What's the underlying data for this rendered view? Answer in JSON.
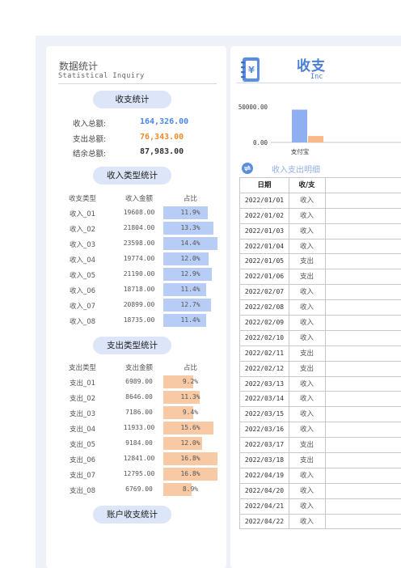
{
  "left": {
    "title": "数据统计",
    "subtitle": "Statistical Inquiry",
    "summary_pill": "收支统计",
    "summary": [
      {
        "label": "收入总额:",
        "value": "164,326.00",
        "color": "#4a86e8"
      },
      {
        "label": "支出总额:",
        "value": "76,343.00",
        "color": "#f08a2c"
      },
      {
        "label": "结余总额:",
        "value": "87,983.00",
        "color": "#333333"
      }
    ],
    "income_pill": "收入类型统计",
    "income_headers": {
      "type": "收支类型",
      "amount": "收入金额",
      "pct": "占比"
    },
    "income_rows": [
      {
        "type": "收入_01",
        "amount": "19608.00",
        "pct": "11.9%",
        "share": 0.119
      },
      {
        "type": "收入_02",
        "amount": "21804.00",
        "pct": "13.3%",
        "share": 0.133
      },
      {
        "type": "收入_03",
        "amount": "23598.00",
        "pct": "14.4%",
        "share": 0.144
      },
      {
        "type": "收入_04",
        "amount": "19774.00",
        "pct": "12.0%",
        "share": 0.12
      },
      {
        "type": "收入_05",
        "amount": "21190.00",
        "pct": "12.9%",
        "share": 0.129
      },
      {
        "type": "收入_06",
        "amount": "18718.00",
        "pct": "11.4%",
        "share": 0.114
      },
      {
        "type": "收入_07",
        "amount": "20899.00",
        "pct": "12.7%",
        "share": 0.127
      },
      {
        "type": "收入_08",
        "amount": "18735.00",
        "pct": "11.4%",
        "share": 0.114
      }
    ],
    "expense_pill": "支出类型统计",
    "expense_headers": {
      "type": "支出类型",
      "amount": "支出金额",
      "pct": "占比"
    },
    "expense_rows": [
      {
        "type": "支出_01",
        "amount": "6989.00",
        "pct": "9.2%",
        "share": 0.092
      },
      {
        "type": "支出_02",
        "amount": "8646.00",
        "pct": "11.3%",
        "share": 0.113
      },
      {
        "type": "支出_03",
        "amount": "7186.00",
        "pct": "9.4%",
        "share": 0.094
      },
      {
        "type": "支出_04",
        "amount": "11933.00",
        "pct": "15.6%",
        "share": 0.156
      },
      {
        "type": "支出_05",
        "amount": "9184.00",
        "pct": "12.0%",
        "share": 0.12
      },
      {
        "type": "支出_06",
        "amount": "12841.00",
        "pct": "16.8%",
        "share": 0.168
      },
      {
        "type": "支出_07",
        "amount": "12795.00",
        "pct": "16.8%",
        "share": 0.168
      },
      {
        "type": "支出_08",
        "amount": "6769.00",
        "pct": "8.9%",
        "share": 0.089
      }
    ],
    "account_pill": "账户收支统计",
    "colors": {
      "income_bar": "#b7cdf6",
      "expense_bar": "#f7c9a4"
    }
  },
  "right": {
    "title": "收支",
    "subtitle": "Inc",
    "icon": "ledger-book-icon",
    "detail_title": "收入支出明细",
    "refresh_icon": "refresh-icon",
    "ledger_headers": {
      "date": "日期",
      "type": "收/支"
    },
    "ledger_rows": [
      {
        "date": "2022/01/01",
        "type": "收入"
      },
      {
        "date": "2022/01/02",
        "type": "收入"
      },
      {
        "date": "2022/01/03",
        "type": "收入"
      },
      {
        "date": "2022/01/04",
        "type": "收入"
      },
      {
        "date": "2022/01/05",
        "type": "支出"
      },
      {
        "date": "2022/01/06",
        "type": "支出"
      },
      {
        "date": "2022/02/07",
        "type": "收入"
      },
      {
        "date": "2022/02/08",
        "type": "收入"
      },
      {
        "date": "2022/02/09",
        "type": "收入"
      },
      {
        "date": "2022/02/10",
        "type": "收入"
      },
      {
        "date": "2022/02/11",
        "type": "支出"
      },
      {
        "date": "2022/02/12",
        "type": "支出"
      },
      {
        "date": "2022/03/13",
        "type": "收入"
      },
      {
        "date": "2022/03/14",
        "type": "收入"
      },
      {
        "date": "2022/03/15",
        "type": "收入"
      },
      {
        "date": "2022/03/16",
        "type": "收入"
      },
      {
        "date": "2022/03/17",
        "type": "支出"
      },
      {
        "date": "2022/03/18",
        "type": "支出"
      },
      {
        "date": "2022/04/19",
        "type": "收入"
      },
      {
        "date": "2022/04/20",
        "type": "收入"
      },
      {
        "date": "2022/04/21",
        "type": "收入"
      },
      {
        "date": "2022/04/22",
        "type": "收入"
      }
    ]
  },
  "chart_data": {
    "type": "bar",
    "categories": [
      "支付宝"
    ],
    "series": [
      {
        "values": [
          46000
        ],
        "color": "#8fb0f0"
      },
      {
        "values": [
          9000
        ],
        "color": "#f7b88a"
      }
    ],
    "ytick_labels": [
      "50000.00",
      "0.00"
    ],
    "ylim": [
      0,
      50000
    ]
  }
}
